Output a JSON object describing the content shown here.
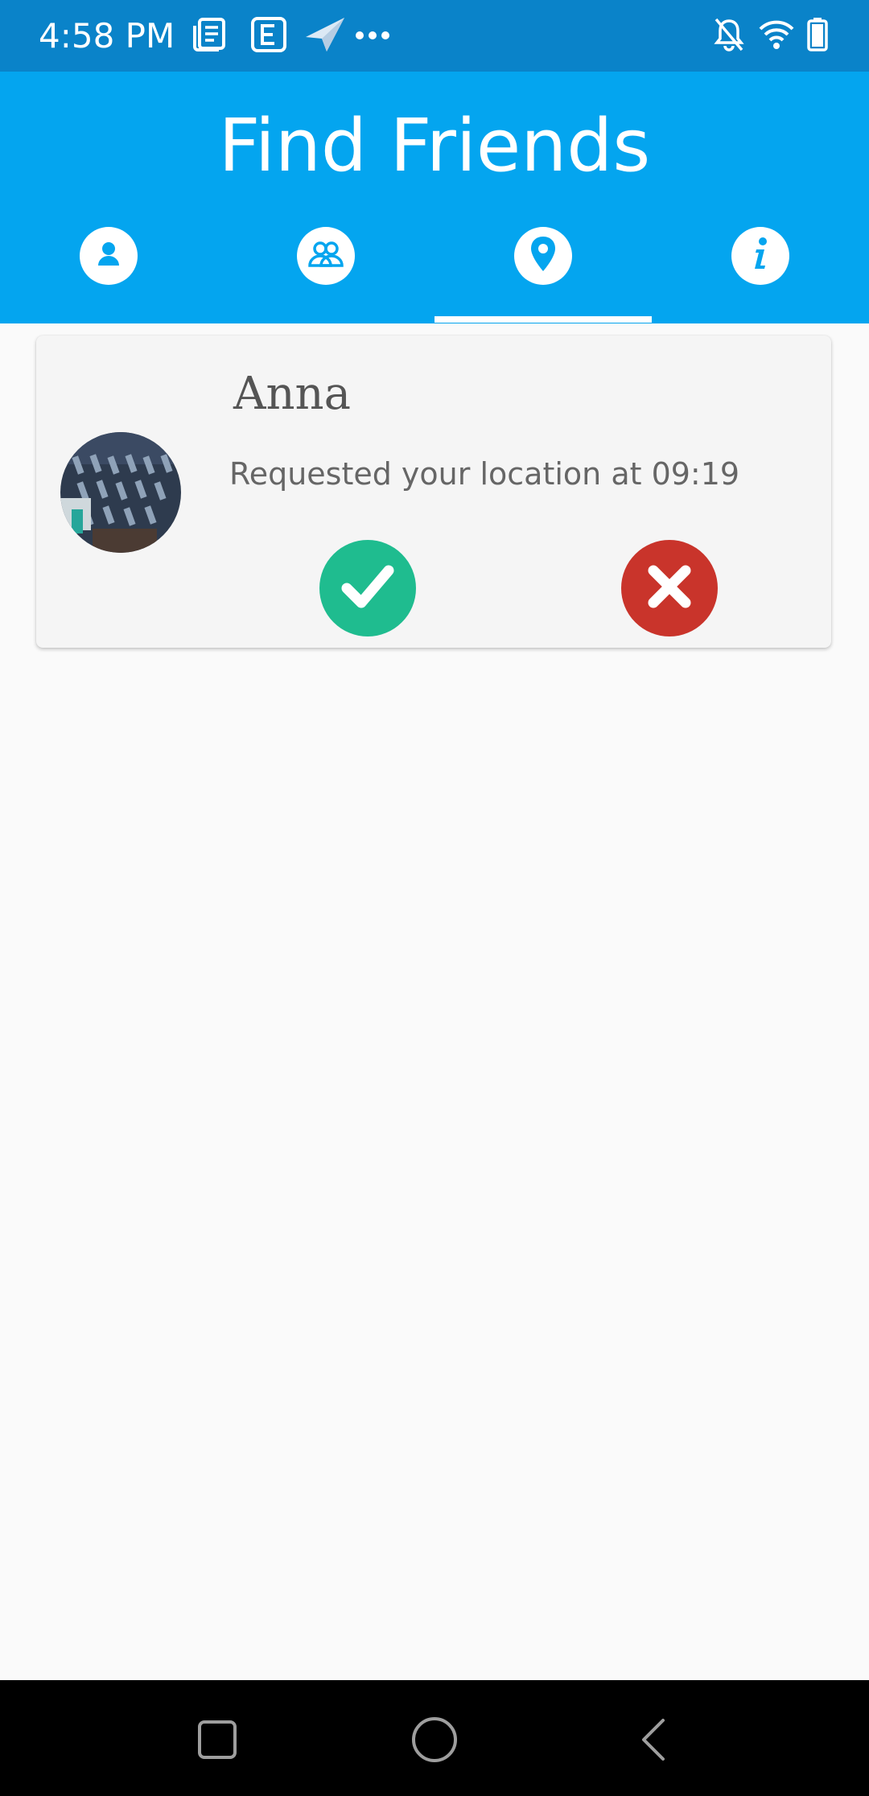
{
  "status_bar": {
    "time": "4:58 PM",
    "left_icons": [
      "news-icon",
      "e-icon",
      "send-arrow-icon",
      "more-dots-icon"
    ],
    "right_icons": [
      "bell-off-icon",
      "wifi-icon",
      "battery-icon"
    ]
  },
  "app": {
    "title": "Find Friends",
    "tabs": [
      {
        "icon": "person-icon",
        "selected": false
      },
      {
        "icon": "group-icon",
        "selected": false
      },
      {
        "icon": "location-pin-icon",
        "selected": true
      },
      {
        "icon": "info-icon",
        "selected": false
      }
    ]
  },
  "requests": [
    {
      "name": "Anna",
      "message": "Requested your location at 09:19",
      "accept_icon": "check-icon",
      "reject_icon": "close-icon"
    }
  ],
  "nav": {
    "buttons": [
      "recents-icon",
      "home-icon",
      "back-icon"
    ]
  },
  "colors": {
    "status_bar": "#0a83c9",
    "app_bar": "#04a5ef",
    "accept": "#1fbc8f",
    "reject": "#c9342b",
    "background": "#fafafa"
  }
}
